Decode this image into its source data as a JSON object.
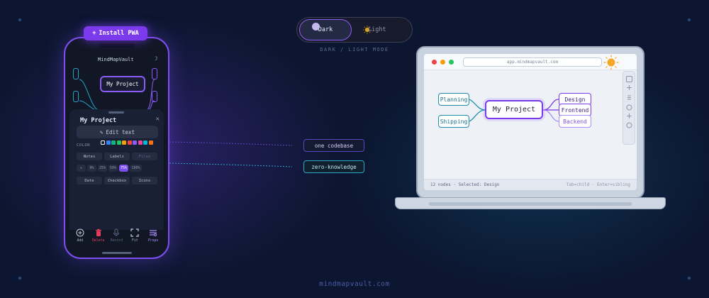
{
  "phone": {
    "pwa_button": "Install PWA",
    "app_title": "MindMapVault",
    "center_node": "My Project",
    "sheet": {
      "title": "My Project",
      "edit_button": "Edit text",
      "color_label": "COLOR",
      "swatches": [
        "#ffffff",
        "#3b82f6",
        "#10b981",
        "#22c55e",
        "#f59e0b",
        "#ef4444",
        "#8b5cf6",
        "#ec4899",
        "#06b6d4",
        "#f97316"
      ],
      "chips_row1": [
        "Notes",
        "Labels",
        "Files"
      ],
      "percent_chips": [
        "0%",
        "25%",
        "50%",
        "75%",
        "100%"
      ],
      "percent_active": "75%",
      "chips_row3": [
        "Date",
        "Checkbox",
        "Icons"
      ]
    },
    "toolbar": {
      "add": "Add",
      "delete": "Delete",
      "record": "Record",
      "fit": "Fit",
      "props": "Props"
    }
  },
  "mode_toggle": {
    "dark": "Dark",
    "light": "Light",
    "caption": "DARK / LIGHT MODE"
  },
  "callouts": {
    "first": "one codebase",
    "second": "zero-knowledge"
  },
  "laptop": {
    "url": "app.mindmapvault.com",
    "center_node": "My Project",
    "left_nodes": [
      "Planning",
      "Shipping"
    ],
    "right_nodes": [
      "Design",
      "Frontend",
      "Backend"
    ],
    "status_left": "12 nodes · Selected: Design",
    "status_right": "Tab=child · Enter=sibling"
  },
  "footer": "mindmapvault.com",
  "colors": {
    "accent": "#7c3aed",
    "teal": "#1f8fb0",
    "background": "#0c1630"
  }
}
